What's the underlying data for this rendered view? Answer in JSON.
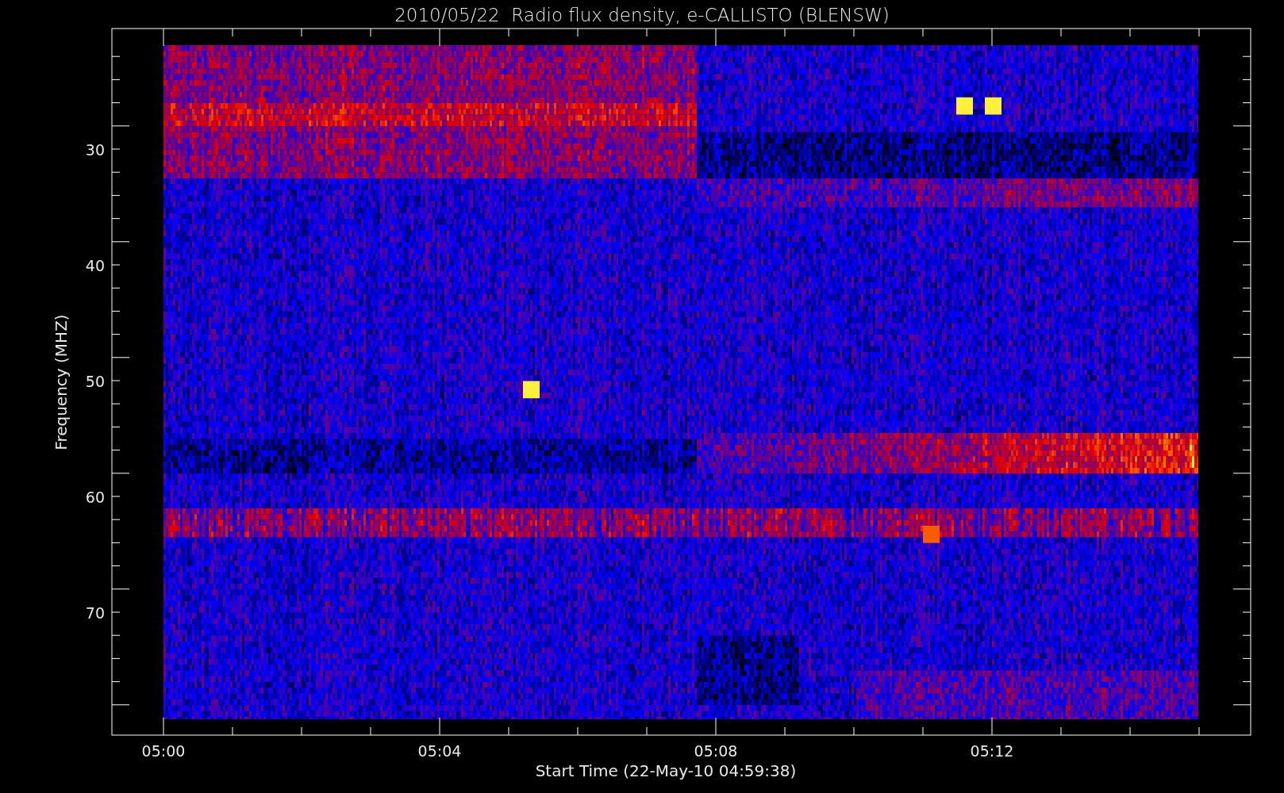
{
  "plot": {
    "title": "2010/05/22  Radio flux density, e-CALLISTO (BLENSW)",
    "xlabel": "Start Time (22-May-10 04:59:38)",
    "ylabel": "Frequency (MHZ)",
    "xticks": [
      "05:00",
      "05:04",
      "05:08",
      "05:12"
    ],
    "yticks": [
      "30",
      "40",
      "50",
      "60",
      "70"
    ]
  }
}
